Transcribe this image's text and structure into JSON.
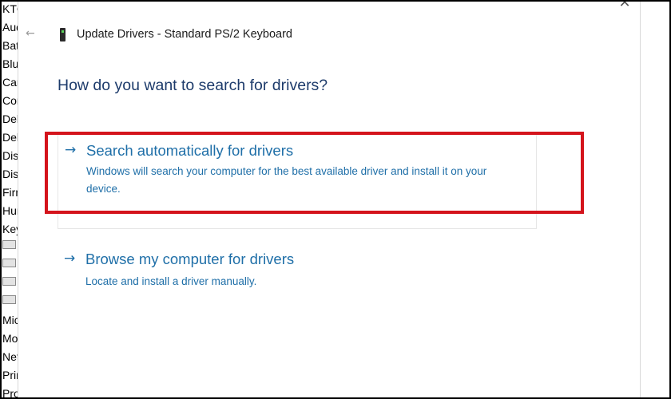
{
  "background_list": {
    "items": [
      "KTC",
      "Aud",
      "Bat",
      "Blu",
      "Can",
      "Com",
      "Del",
      "Del",
      "Disk",
      "Disp",
      "Firm",
      "Hum",
      "Key",
      "",
      "",
      "",
      "",
      "Mic",
      "Mo",
      "Net",
      "Prin",
      "Pro"
    ]
  },
  "window": {
    "title": "Update Drivers - Standard PS/2 Keyboard",
    "close_label": "✕",
    "back_label": "←"
  },
  "heading": "How do you want to search for drivers?",
  "options": [
    {
      "title": "Search automatically for drivers",
      "description": "Windows will search your computer for the best available driver and install it on your device."
    },
    {
      "title": "Browse my computer for drivers",
      "description": "Locate and install a driver manually."
    }
  ],
  "colors": {
    "link": "#1f6fa8",
    "heading": "#1d3b6b",
    "highlight": "#d4141c"
  }
}
